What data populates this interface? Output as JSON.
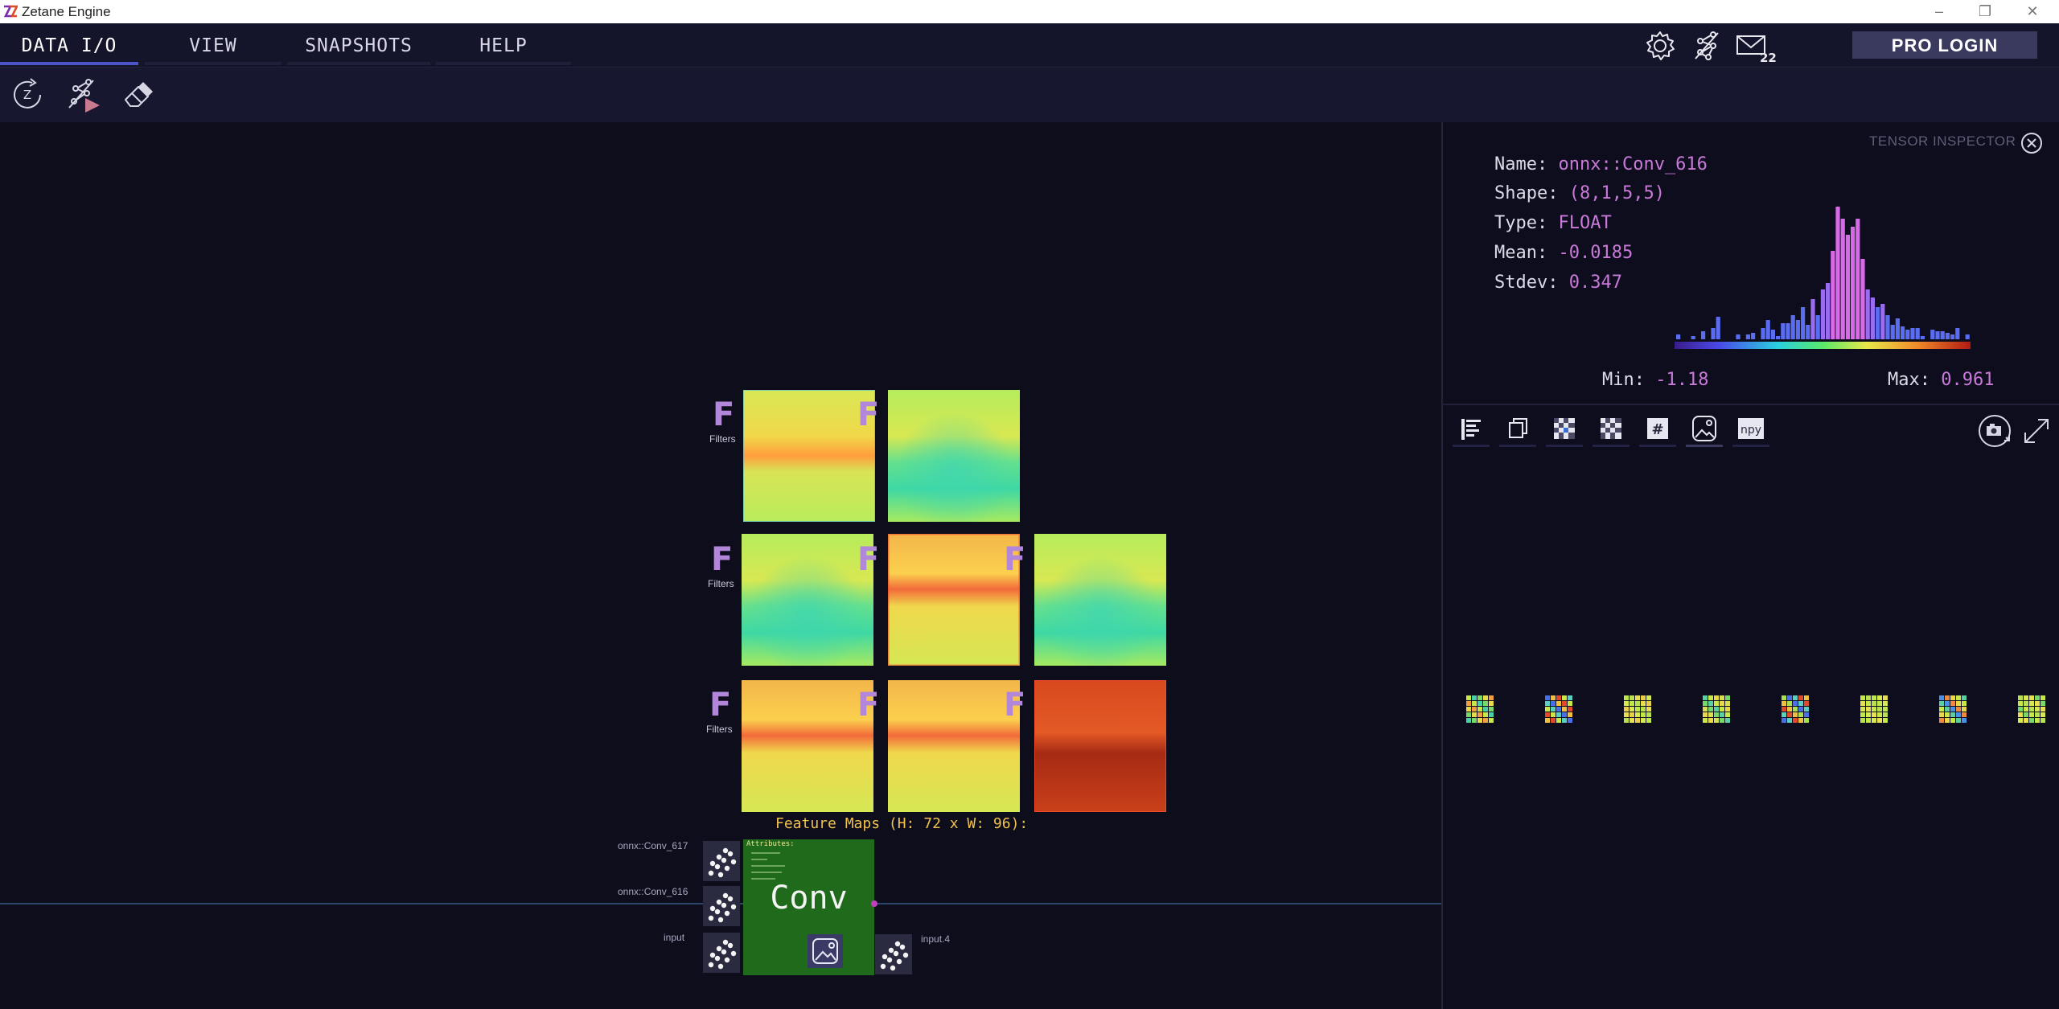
{
  "window": {
    "title": "Zetane Engine"
  },
  "menu": {
    "tabs": [
      {
        "label": "DATA I/O",
        "active": true
      },
      {
        "label": "VIEW",
        "active": false
      },
      {
        "label": "SNAPSHOTS",
        "active": false
      },
      {
        "label": "HELP",
        "active": false
      }
    ],
    "mail_badge": "22",
    "pro_login": "PRO LOGIN"
  },
  "toolbar": {
    "reset_glyph": "Z"
  },
  "canvas": {
    "feature_maps": {
      "caption": "Feature Maps (H: 72 x W: 96):",
      "badge_letter": "F",
      "badge_label": "Filters"
    },
    "node": {
      "name": "Conv",
      "attributes_label": "Attributes:",
      "inputs": [
        "onnx::Conv_617",
        "onnx::Conv_616",
        "input"
      ],
      "output": "input.4"
    }
  },
  "inspector": {
    "title": "TENSOR INSPECTOR",
    "name_label": "Name:",
    "name": "onnx::Conv_616",
    "shape_label": "Shape:",
    "shape": "(8,1,5,5)",
    "type_label": "Type:",
    "type": "FLOAT",
    "mean_label": "Mean:",
    "mean": "-0.0185",
    "stdev_label": "Stdev:",
    "stdev": "0.347",
    "min_label": "Min:",
    "min": "-1.18",
    "max_label": "Max:",
    "max": "0.961",
    "view_tabs": [
      {
        "icon": "bar-list-icon"
      },
      {
        "icon": "copy-layers-icon"
      },
      {
        "icon": "checker-icon"
      },
      {
        "icon": "checker-alt-icon"
      },
      {
        "icon": "hash-icon",
        "text": "#"
      },
      {
        "icon": "image-icon",
        "active": true
      },
      {
        "icon": "npy-icon",
        "text": "npy"
      }
    ]
  }
}
